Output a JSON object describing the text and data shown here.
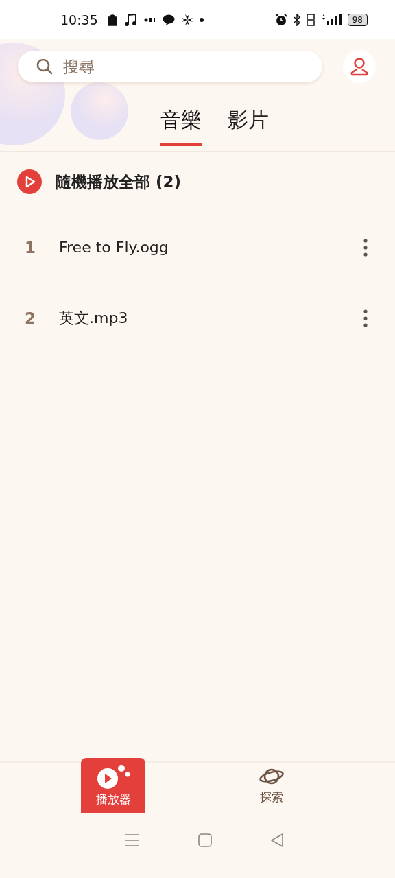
{
  "status_bar": {
    "time": "10:35",
    "battery": "98"
  },
  "search": {
    "placeholder": "搜尋"
  },
  "tabs": [
    {
      "label": "音樂",
      "selected": true
    },
    {
      "label": "影片",
      "selected": false
    }
  ],
  "shuffle": {
    "label": "隨機播放全部 (2)"
  },
  "tracks": [
    {
      "number": "1",
      "title": "Free to Fly.ogg"
    },
    {
      "number": "2",
      "title": "英文.mp3"
    }
  ],
  "bottom_nav": [
    {
      "label": "播放器",
      "kind": "player",
      "selected": true
    },
    {
      "label": "探索",
      "kind": "explore",
      "selected": false
    }
  ]
}
